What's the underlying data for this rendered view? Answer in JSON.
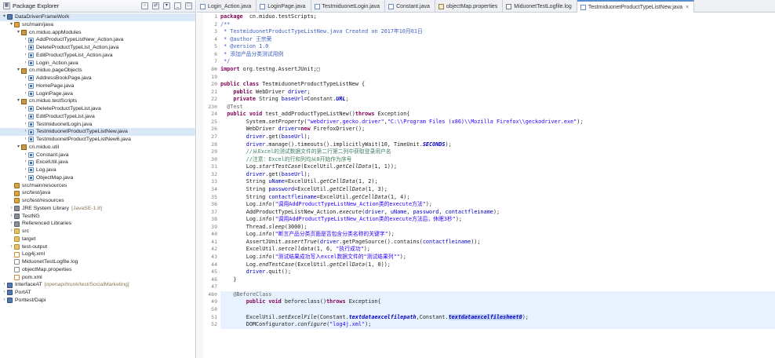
{
  "package_explorer": {
    "title": "Package Explorer",
    "tree": [
      {
        "level": 0,
        "twisty": "▾",
        "icon": "project",
        "label": "DataDrivenFrameWork",
        "selected": true
      },
      {
        "level": 1,
        "twisty": "▾",
        "icon": "srcfolder",
        "label": "src/main/java"
      },
      {
        "level": 2,
        "twisty": "▾",
        "icon": "package",
        "label": "cn.miduo.appModules"
      },
      {
        "level": 3,
        "twisty": "›",
        "icon": "java",
        "label": "AddProductTypeListNew_Action.java"
      },
      {
        "level": 3,
        "twisty": "›",
        "icon": "java",
        "label": "DeleteProductTypeList_Action.java"
      },
      {
        "level": 3,
        "twisty": "›",
        "icon": "java",
        "label": "EditProductTypeList_Action.java"
      },
      {
        "level": 3,
        "twisty": "›",
        "icon": "java",
        "label": "Login_Action.java"
      },
      {
        "level": 2,
        "twisty": "▾",
        "icon": "package",
        "label": "cn.miduo.pageObjects"
      },
      {
        "level": 3,
        "twisty": "›",
        "icon": "java",
        "label": "AddressBookPage.java"
      },
      {
        "level": 3,
        "twisty": "›",
        "icon": "java",
        "label": "HomePage.java"
      },
      {
        "level": 3,
        "twisty": "›",
        "icon": "java",
        "label": "LoginPage.java"
      },
      {
        "level": 2,
        "twisty": "▾",
        "icon": "package",
        "label": "cn.miduo.testScripts"
      },
      {
        "level": 3,
        "twisty": "›",
        "icon": "java",
        "label": "DeleteProductTypeList.java"
      },
      {
        "level": 3,
        "twisty": "›",
        "icon": "java",
        "label": "EditProductTypeList.java"
      },
      {
        "level": 3,
        "twisty": "›",
        "icon": "java",
        "label": "TestmiduonetLogin.java"
      },
      {
        "level": 3,
        "twisty": "›",
        "icon": "java",
        "label": "TestmiduonetProductTypeListNew.java",
        "selected": true
      },
      {
        "level": 3,
        "twisty": "›",
        "icon": "java",
        "label": "TestmiduonetProductTypeListNew6.java"
      },
      {
        "level": 2,
        "twisty": "▾",
        "icon": "package",
        "label": "cn.miduo.util"
      },
      {
        "level": 3,
        "twisty": "›",
        "icon": "java",
        "label": "Constant.java"
      },
      {
        "level": 3,
        "twisty": "›",
        "icon": "java",
        "label": "ExcelUtil.java"
      },
      {
        "level": 3,
        "twisty": "›",
        "icon": "java",
        "label": "Log.java"
      },
      {
        "level": 3,
        "twisty": "›",
        "icon": "java",
        "label": "ObjectMap.java"
      },
      {
        "level": 1,
        "twisty": "",
        "icon": "srcfolder",
        "label": "src/main/resources"
      },
      {
        "level": 1,
        "twisty": "",
        "icon": "srcfolder",
        "label": "src/test/java"
      },
      {
        "level": 1,
        "twisty": "",
        "icon": "srcfolder",
        "label": "src/test/resources"
      },
      {
        "level": 1,
        "twisty": "›",
        "icon": "lib",
        "label": "JRE System Library",
        "extra": "[JavaSE-1.8]"
      },
      {
        "level": 1,
        "twisty": "›",
        "icon": "lib",
        "label": "TestNG"
      },
      {
        "level": 1,
        "twisty": "›",
        "icon": "lib",
        "label": "Referenced Libraries"
      },
      {
        "level": 1,
        "twisty": "›",
        "icon": "folder",
        "label": "src"
      },
      {
        "level": 1,
        "twisty": "",
        "icon": "folder",
        "label": "target"
      },
      {
        "level": 1,
        "twisty": "›",
        "icon": "folder",
        "label": "test-output"
      },
      {
        "level": 1,
        "twisty": "",
        "icon": "xml",
        "label": "Log4j.xml"
      },
      {
        "level": 1,
        "twisty": "",
        "icon": "file",
        "label": "MiduonetTestLogfile.log"
      },
      {
        "level": 1,
        "twisty": "",
        "icon": "file",
        "label": "objectMap.properties"
      },
      {
        "level": 1,
        "twisty": "",
        "icon": "xml",
        "label": "pom.xml"
      },
      {
        "level": 0,
        "twisty": "›",
        "icon": "project",
        "label": "InterfaceAT",
        "extra": "[openapi/trunk/test/SocialMarketing]"
      },
      {
        "level": 0,
        "twisty": "›",
        "icon": "project",
        "label": "PortAT"
      },
      {
        "level": 0,
        "twisty": "›",
        "icon": "project",
        "label": "Porttest/Dapi"
      }
    ]
  },
  "tabs": [
    {
      "label": "Login_Action.java",
      "icon": "java"
    },
    {
      "label": "LoginPage.java",
      "icon": "java"
    },
    {
      "label": "TestmiduonetLogin.java",
      "icon": "java"
    },
    {
      "label": "Constant.java",
      "icon": "java"
    },
    {
      "label": "objectMap.properties",
      "icon": "prop"
    },
    {
      "label": "MiduonetTestLogfile.log",
      "icon": "log"
    },
    {
      "label": "TestmiduonetProductTypeListNew.java",
      "icon": "java",
      "active": true,
      "close": "×"
    }
  ],
  "editor": {
    "lines": [
      {
        "n": "1",
        "tokens": [
          [
            "kw",
            "package"
          ],
          [
            "",
            "  cn.miduo.testScripts;"
          ]
        ]
      },
      {
        "n": "2",
        "tokens": [
          [
            "jd",
            "/**"
          ]
        ]
      },
      {
        "n": "3",
        "tokens": [
          [
            "jd",
            " * TestmiduonetProductTypeListNew.java Created on 2017年10月01日"
          ]
        ]
      },
      {
        "n": "4",
        "tokens": [
          [
            "jd",
            " * @author 王宗荣"
          ]
        ]
      },
      {
        "n": "5",
        "tokens": [
          [
            "jd",
            " * @version 1.0"
          ]
        ]
      },
      {
        "n": "6",
        "tokens": [
          [
            "jd",
            " * 添加产品分类测试用例"
          ]
        ]
      },
      {
        "n": "7",
        "tokens": [
          [
            "jd",
            " */"
          ]
        ]
      },
      {
        "n": "8⊕",
        "tokens": [
          [
            "kw",
            "import"
          ],
          [
            "",
            " org.testng.AssertJUnit;□"
          ]
        ]
      },
      {
        "n": "19",
        "tokens": []
      },
      {
        "n": "20",
        "tokens": [
          [
            "kw",
            "public class"
          ],
          [
            "",
            " TestmiduonetProductTypeListNew {"
          ]
        ]
      },
      {
        "n": "21",
        "tokens": [
          [
            "",
            "    "
          ],
          [
            "kw",
            "public"
          ],
          [
            "",
            " WebDriver "
          ],
          [
            "fd",
            "driver"
          ],
          [
            "",
            ";"
          ]
        ]
      },
      {
        "n": "22",
        "tokens": [
          [
            "",
            "    "
          ],
          [
            "kw",
            "private"
          ],
          [
            "",
            " String "
          ],
          [
            "fd",
            "baseUrl"
          ],
          [
            "",
            "=Constant."
          ],
          [
            "sf",
            "URL"
          ],
          [
            "",
            ";"
          ]
        ]
      },
      {
        "n": "23⊖",
        "tokens": [
          [
            "an",
            "  @Test"
          ]
        ]
      },
      {
        "n": "24",
        "tokens": [
          [
            "",
            "  "
          ],
          [
            "kw",
            "public void"
          ],
          [
            "",
            " test_addProductTypeListNew()"
          ],
          [
            "kw",
            "throws"
          ],
          [
            "",
            " Exception{"
          ]
        ]
      },
      {
        "n": "25",
        "tokens": [
          [
            "",
            "        System."
          ],
          [
            "sm",
            "setProperty"
          ],
          [
            "",
            "("
          ],
          [
            "st",
            "\"webdriver.gecko.driver\""
          ],
          [
            "",
            ","
          ],
          [
            "st",
            "\"C:\\\\Program Files (x86)\\\\Mozilla Firefox\\\\geckodriver.exe\""
          ],
          [
            "",
            ");"
          ]
        ]
      },
      {
        "n": "26",
        "tokens": [
          [
            "",
            "        WebDriver "
          ],
          [
            "fd",
            "driver"
          ],
          [
            "",
            "="
          ],
          [
            "kw",
            "new"
          ],
          [
            "",
            " FirefoxDriver();"
          ]
        ]
      },
      {
        "n": "27",
        "tokens": [
          [
            "",
            "        "
          ],
          [
            "fd",
            "driver"
          ],
          [
            "",
            ".get("
          ],
          [
            "fd",
            "baseUrl"
          ],
          [
            "",
            ");"
          ]
        ]
      },
      {
        "n": "28",
        "tokens": [
          [
            "",
            "        "
          ],
          [
            "fd",
            "driver"
          ],
          [
            "",
            ".manage().timeouts().implicitlyWait(10, TimeUnit."
          ],
          [
            "sf",
            "SECONDS"
          ],
          [
            "",
            ");"
          ]
        ]
      },
      {
        "n": "29",
        "tokens": [
          [
            "cm",
            "        //从Excel的测试数据文件的第二行第二列中获取登录用户名"
          ]
        ]
      },
      {
        "n": "30",
        "tokens": [
          [
            "cm",
            "        //注意：Excel的行和列均从0开始作为序号"
          ]
        ]
      },
      {
        "n": "31",
        "tokens": [
          [
            "",
            "        Log."
          ],
          [
            "sm",
            "startTestCase"
          ],
          [
            "",
            "(ExcelUtil."
          ],
          [
            "sm",
            "getCellData"
          ],
          [
            "",
            "(1, 1));"
          ]
        ]
      },
      {
        "n": "32",
        "tokens": [
          [
            "",
            "        "
          ],
          [
            "fd",
            "driver"
          ],
          [
            "",
            ".get("
          ],
          [
            "fd",
            "baseUrl"
          ],
          [
            "",
            ");"
          ]
        ]
      },
      {
        "n": "33",
        "tokens": [
          [
            "",
            "        String "
          ],
          [
            "fd",
            "uName"
          ],
          [
            "",
            "=ExcelUtil."
          ],
          [
            "sm",
            "getCellData"
          ],
          [
            "",
            "(1, 2);"
          ]
        ]
      },
      {
        "n": "34",
        "tokens": [
          [
            "",
            "        String "
          ],
          [
            "fd",
            "password"
          ],
          [
            "",
            "=ExcelUtil."
          ],
          [
            "sm",
            "getCellData"
          ],
          [
            "",
            "(1, 3);"
          ]
        ]
      },
      {
        "n": "35",
        "tokens": [
          [
            "",
            "        String "
          ],
          [
            "fd",
            "contactfleiname"
          ],
          [
            "",
            "=ExcelUtil."
          ],
          [
            "sm",
            "getCellData"
          ],
          [
            "",
            "(1, 4);"
          ]
        ]
      },
      {
        "n": "36",
        "tokens": [
          [
            "",
            "        Log."
          ],
          [
            "sm",
            "info"
          ],
          [
            "",
            "("
          ],
          [
            "st",
            "\"调用AddProductTypeListNew_Action类的execute方法\""
          ],
          [
            "",
            ");"
          ]
        ]
      },
      {
        "n": "37",
        "tokens": [
          [
            "",
            "        AddProductTypeListNew_Action."
          ],
          [
            "sm",
            "execute"
          ],
          [
            "",
            "("
          ],
          [
            "fd",
            "driver"
          ],
          [
            "",
            ", "
          ],
          [
            "fd",
            "uName"
          ],
          [
            "",
            ", "
          ],
          [
            "fd",
            "password"
          ],
          [
            "",
            ", "
          ],
          [
            "fd",
            "contactfleiname"
          ],
          [
            "",
            ");"
          ]
        ]
      },
      {
        "n": "38",
        "tokens": [
          [
            "",
            "        Log."
          ],
          [
            "sm",
            "info"
          ],
          [
            "",
            "("
          ],
          [
            "st",
            "\"调用AddProductTypeListNew_Action类的execute方法后，休眠3秒\""
          ],
          [
            "",
            ");"
          ]
        ]
      },
      {
        "n": "39",
        "tokens": [
          [
            "",
            "        Thread."
          ],
          [
            "sm",
            "sleep"
          ],
          [
            "",
            "(3000);"
          ]
        ]
      },
      {
        "n": "40",
        "tokens": [
          [
            "",
            "        Log."
          ],
          [
            "sm",
            "info"
          ],
          [
            "",
            "("
          ],
          [
            "st",
            "\"断言产品分类页面是否包含分类名称的关键字\""
          ],
          [
            "",
            ");"
          ]
        ]
      },
      {
        "n": "41",
        "tokens": [
          [
            "",
            "        AssertJUnit."
          ],
          [
            "sm",
            "assertTrue"
          ],
          [
            "",
            "("
          ],
          [
            "fd",
            "driver"
          ],
          [
            "",
            ".getPageSource().contains("
          ],
          [
            "fd",
            "contactfleiname"
          ],
          [
            "",
            "));"
          ]
        ]
      },
      {
        "n": "42",
        "tokens": [
          [
            "",
            "        ExcelUtil."
          ],
          [
            "sm",
            "setcelldata"
          ],
          [
            "",
            "(1, 6, "
          ],
          [
            "st",
            "\"执行成功\""
          ],
          [
            "",
            ");"
          ]
        ]
      },
      {
        "n": "43",
        "tokens": [
          [
            "",
            "        Log."
          ],
          [
            "sm",
            "info"
          ],
          [
            "",
            "("
          ],
          [
            "st",
            "\"测试结果成功写入excel数据文件的\"测试结果列\"\""
          ],
          [
            "",
            ");"
          ]
        ]
      },
      {
        "n": "44",
        "tokens": [
          [
            "",
            "        Log."
          ],
          [
            "sm",
            "endTestCase"
          ],
          [
            "",
            "(ExcelUtil."
          ],
          [
            "sm",
            "getCellData"
          ],
          [
            "",
            "(1, 0));"
          ]
        ]
      },
      {
        "n": "45",
        "tokens": [
          [
            "",
            "        "
          ],
          [
            "fd",
            "driver"
          ],
          [
            "",
            ".quit();"
          ]
        ]
      },
      {
        "n": "46",
        "tokens": [
          [
            "",
            "    }"
          ]
        ]
      },
      {
        "n": "47",
        "tokens": []
      },
      {
        "n": "48⊖",
        "tokens": [
          [
            "an",
            "    @BeforeClass"
          ]
        ],
        "highlight": true
      },
      {
        "n": "49",
        "tokens": [
          [
            "",
            "        "
          ],
          [
            "kw",
            "public void"
          ],
          [
            "",
            " beforeclass()"
          ],
          [
            "kw",
            "throws"
          ],
          [
            "",
            " Exception{"
          ]
        ],
        "highlight": true
      },
      {
        "n": "50",
        "tokens": [],
        "highlight": true
      },
      {
        "n": "51",
        "tokens": [
          [
            "",
            "        ExcelUtil."
          ],
          [
            "sm",
            "setExcelFile"
          ],
          [
            "",
            "(Constant."
          ],
          [
            "sf",
            "textdataexcelfilepath"
          ],
          [
            "",
            ",Constant."
          ],
          [
            "sf sel",
            "textdataexcelfilesheet0"
          ],
          [
            "",
            ");"
          ]
        ],
        "highlight": true
      },
      {
        "n": "52",
        "tokens": [
          [
            "",
            "        DOMConfigurator."
          ],
          [
            "sm",
            "configure"
          ],
          [
            "",
            "("
          ],
          [
            "st",
            "\"log4j.xml\""
          ],
          [
            "",
            ");"
          ]
        ],
        "highlight": true
      }
    ]
  },
  "colors": {
    "accent": "#5a8ad0",
    "selection": "#dbe8f8",
    "keyword": "#7f0055",
    "string": "#2a00ff",
    "comment": "#3f7f5f",
    "field": "#0000c0"
  }
}
